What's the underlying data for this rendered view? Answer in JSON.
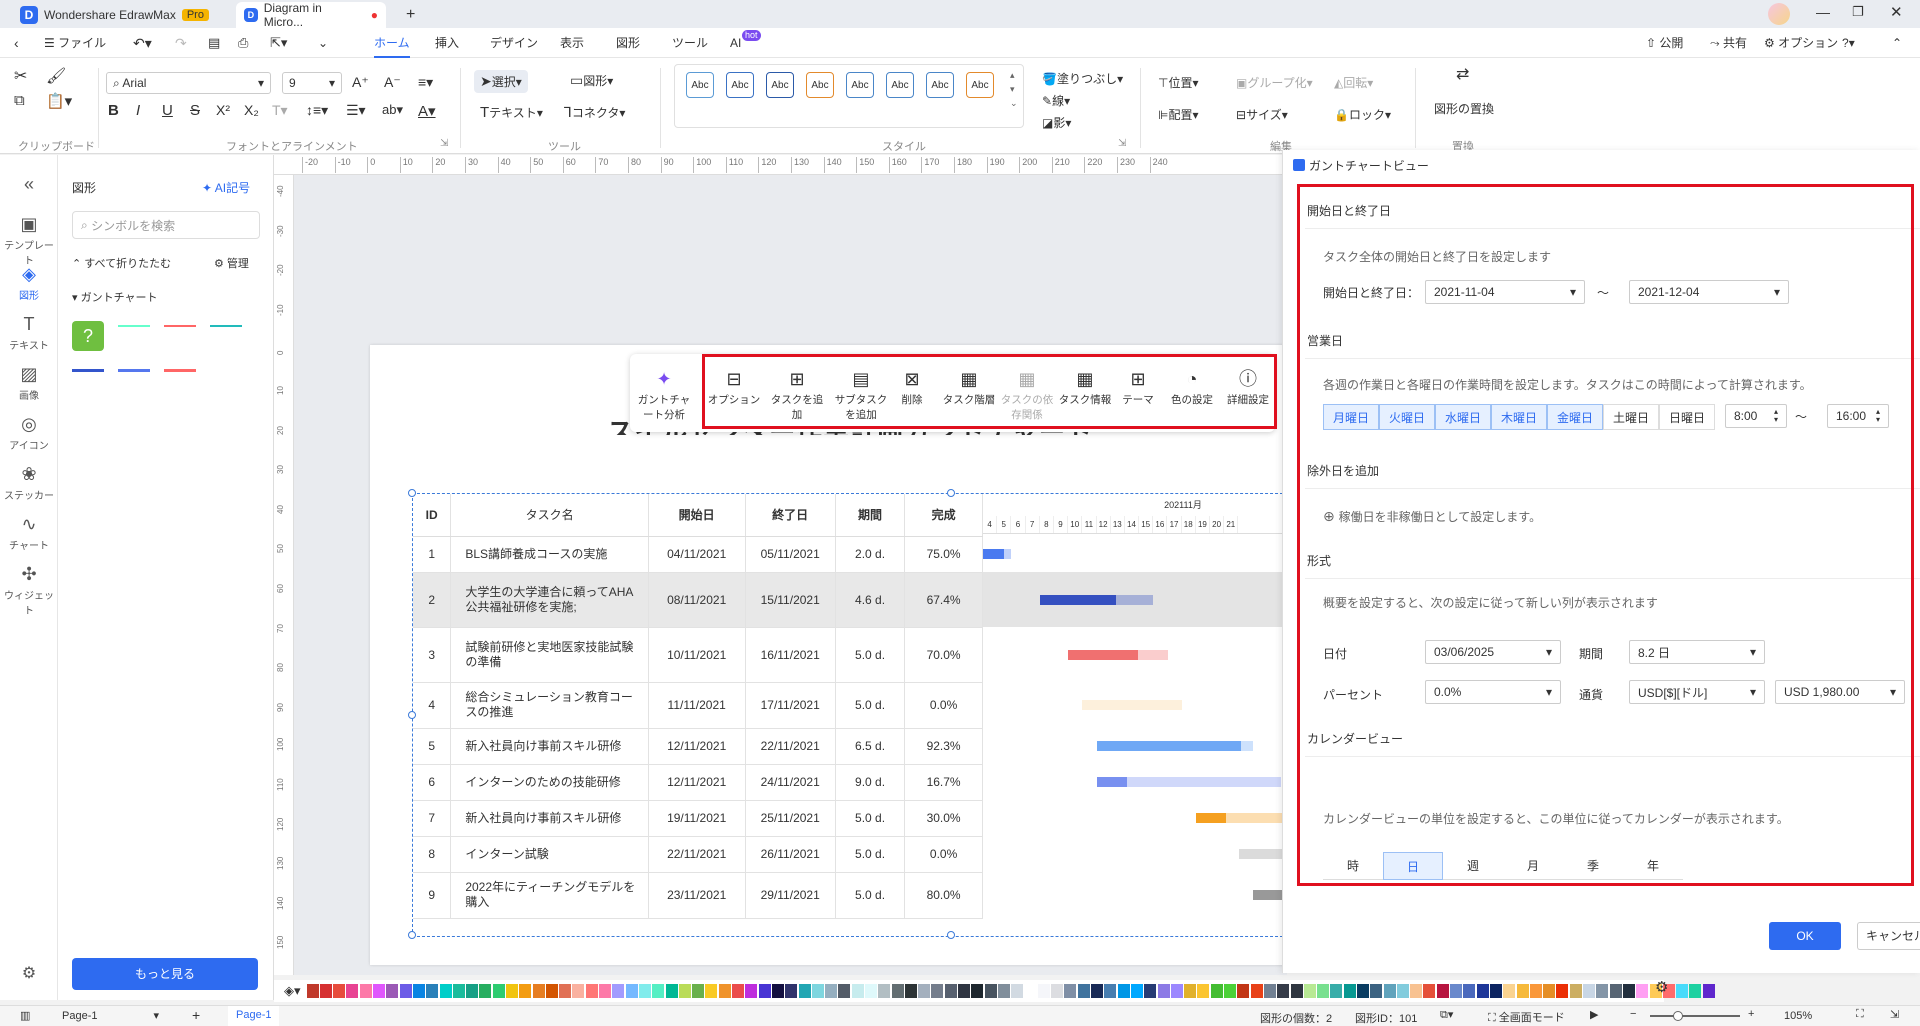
{
  "titlebar": {
    "app_tab": "Wondershare EdrawMax",
    "pro": "Pro",
    "doc_tab": "Diagram in Micro...",
    "add": "+"
  },
  "menubar": {
    "file": "ファイル",
    "items": [
      "ホーム",
      "挿入",
      "デザイン",
      "表示",
      "図形",
      "ツール",
      "AI"
    ],
    "ai_badge": "hot",
    "right": [
      "公開",
      "共有",
      "オプション",
      "?"
    ]
  },
  "ribbon": {
    "font": "Arial",
    "size": "9",
    "select": "選択",
    "shape": "図形",
    "text": "テキスト",
    "connector": "コネクタ",
    "style_box": "Abc",
    "fill": "塗りつぶし",
    "line": "線",
    "shadow": "影",
    "position": "位置",
    "align": "配置",
    "group": "グループ化",
    "rotate": "回転",
    "size_label": "サイズ",
    "lock": "ロック",
    "replace": "図形の置換",
    "groups": {
      "clipboard": "クリップボード",
      "font": "フォントとアラインメント",
      "tools": "ツール",
      "style": "スタイル",
      "edit": "編集",
      "replace": "置換"
    }
  },
  "leftnav": [
    {
      "icon": "«",
      "label": ""
    },
    {
      "icon": "▣",
      "label": "テンプレート"
    },
    {
      "icon": "◈",
      "label": "図形"
    },
    {
      "icon": "T",
      "label": "テキスト"
    },
    {
      "icon": "▨",
      "label": "画像"
    },
    {
      "icon": "◎",
      "label": "アイコン"
    },
    {
      "icon": "❀",
      "label": "ステッカー"
    },
    {
      "icon": "∿",
      "label": "チャート"
    },
    {
      "icon": "✣",
      "label": "ウィジェット"
    }
  ],
  "shapes_panel": {
    "title": "図形",
    "ai": "AI記号",
    "search_placeholder": "シンボルを検索",
    "collapse": "すべて折りたたむ",
    "manage": "管理",
    "category": "ガントチャート",
    "more": "もっと見る"
  },
  "floatbar": {
    "analysis": "ガントチャート分析",
    "items": [
      "オプション",
      "タスクを追加",
      "サブタスクを追加",
      "削除",
      "タスク階層",
      "タスクの依存関係",
      "タスク情報",
      "テーマ",
      "色の設定",
      "詳細設定"
    ]
  },
  "chart_title": "スイルセンター作業計画ガントチャート",
  "gantt": {
    "headers": [
      "ID",
      "タスク名",
      "開始日",
      "終了日",
      "期間",
      "完成"
    ],
    "month": "202111月",
    "days": [
      "4",
      "5",
      "6",
      "7",
      "8",
      "9",
      "10",
      "11",
      "12",
      "13",
      "14",
      "15",
      "16",
      "17",
      "18",
      "19",
      "20",
      "21"
    ],
    "rows": [
      {
        "id": "1",
        "name": "BLS講師養成コースの実施",
        "start": "04/11/2021",
        "end": "05/11/2021",
        "dur": "2.0 d.",
        "pct": "75.0%",
        "color": "#4a7af0"
      },
      {
        "id": "2",
        "name": "大学生の大学連合に頼ってAHA公共福祉研修を実施;",
        "start": "08/11/2021",
        "end": "15/11/2021",
        "dur": "4.6 d.",
        "pct": "67.4%",
        "color": "#3550c0"
      },
      {
        "id": "3",
        "name": "試験前研修と実地医家技能試験の準備",
        "start": "10/11/2021",
        "end": "16/11/2021",
        "dur": "5.0 d.",
        "pct": "70.0%",
        "color": "#f07070"
      },
      {
        "id": "4",
        "name": "総合シミュレーション教育コースの推進",
        "start": "11/11/2021",
        "end": "17/11/2021",
        "dur": "5.0 d.",
        "pct": "0.0%",
        "color": "#f8d49a"
      },
      {
        "id": "5",
        "name": "新入社員向け事前スキル研修",
        "start": "12/11/2021",
        "end": "22/11/2021",
        "dur": "6.5 d.",
        "pct": "92.3%",
        "color": "#6fa8f5"
      },
      {
        "id": "6",
        "name": "インターンのための技能研修",
        "start": "12/11/2021",
        "end": "24/11/2021",
        "dur": "9.0 d.",
        "pct": "16.7%",
        "color": "#7890f0"
      },
      {
        "id": "7",
        "name": "新入社員向け事前スキル研修",
        "start": "19/11/2021",
        "end": "25/11/2021",
        "dur": "5.0 d.",
        "pct": "30.0%",
        "color": "#f5a020"
      },
      {
        "id": "8",
        "name": "インターン試験",
        "start": "22/11/2021",
        "end": "26/11/2021",
        "dur": "5.0 d.",
        "pct": "0.0%",
        "color": "#999"
      },
      {
        "id": "9",
        "name": "2022年にティーチングモデルを購入",
        "start": "23/11/2021",
        "end": "29/11/2021",
        "dur": "5.0 d.",
        "pct": "80.0%",
        "color": "#999"
      }
    ]
  },
  "panel": {
    "title": "ガントチャートビュー",
    "s1": {
      "title": "開始日と終了日",
      "desc": "タスク全体の開始日と終了日を設定します",
      "label": "開始日と終了日：",
      "start": "2021-11-04",
      "tilde": "〜",
      "end": "2021-12-04"
    },
    "s2": {
      "title": "営業日",
      "desc": "各週の作業日と各曜日の作業時間を設定します。タスクはこの時間によって計算されます。",
      "days": [
        "月曜日",
        "火曜日",
        "水曜日",
        "木曜日",
        "金曜日",
        "土曜日",
        "日曜日"
      ],
      "from": "8:00",
      "to": "16:00"
    },
    "s3": {
      "title": "除外日を追加",
      "desc": "稼働日を非稼働日として設定します。"
    },
    "s4": {
      "title": "形式",
      "desc": "概要を設定すると、次の設定に従って新しい列が表示されます",
      "date_label": "日付",
      "date": "03/06/2025",
      "period_label": "期間",
      "period": "8.2 日",
      "percent_label": "パーセント",
      "percent": "0.0%",
      "currency_label": "通貨",
      "currency": "USD[$][ドル]",
      "amount": "USD 1,980.00"
    },
    "s5": {
      "title": "カレンダービュー",
      "desc": "カレンダービューの単位を設定すると、この単位に従ってカレンダーが表示されます。",
      "units": [
        "時",
        "日",
        "週",
        "月",
        "季",
        "年"
      ]
    },
    "ok": "OK",
    "cancel": "キャンセル"
  },
  "status": {
    "page_sel": "Page-1",
    "page_tab": "Page-1",
    "shape_count": "図形の個数：2",
    "shape_id": "図形ID：101",
    "fullscreen": "全画面モード",
    "zoom": "105%"
  }
}
